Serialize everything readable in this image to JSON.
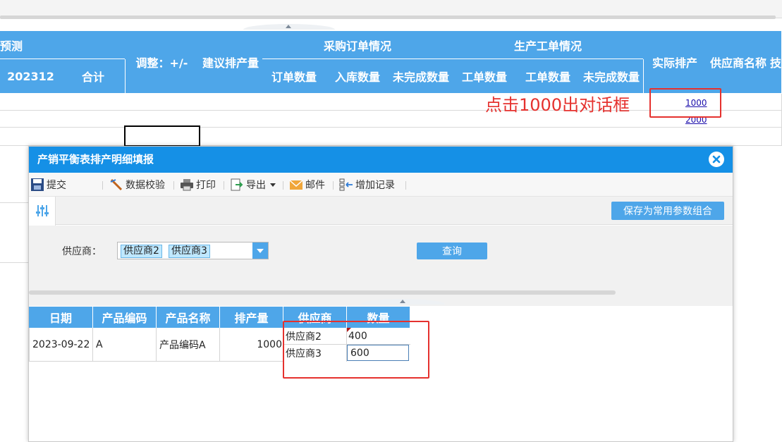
{
  "report": {
    "header": {
      "forecast": "预测",
      "month": "202312",
      "total": "合计",
      "adjust": "调整：+/-",
      "suggested": "建议排产量",
      "purchase_group": "采购订单情况",
      "purchase_cols": [
        "订单数量",
        "入库数量",
        "未完成数量"
      ],
      "production_group": "生产工单情况",
      "production_cols": [
        "工单数量",
        "工单数量",
        "未完成数量"
      ],
      "actual": "实际排产",
      "supplier_name": "供应商名称",
      "cut_off": "技"
    },
    "rows": [
      {
        "actual_link": "1000"
      },
      {
        "actual_link": "2000"
      }
    ],
    "annotation": "点击1000出对话框"
  },
  "dialog": {
    "title": "产销平衡表排产明细填报",
    "toolbar": {
      "submit": "提交",
      "validate": "数据校验",
      "print": "打印",
      "export": "导出",
      "mail": "邮件",
      "add_record": "增加记录"
    },
    "params": {
      "save_combo": "保存为常用参数组合",
      "supplier_label": "供应商：",
      "supplier_selected": [
        "供应商2",
        "供应商3"
      ],
      "query": "查询"
    },
    "table": {
      "headers": [
        "日期",
        "产品编码",
        "产品名称",
        "排产量",
        "供应商",
        "数量"
      ],
      "row": {
        "date": "2023-09-22",
        "code": "A",
        "name": "产品编码A",
        "qty": "1000",
        "subs": [
          {
            "supplier": "供应商2",
            "amount": "400"
          },
          {
            "supplier": "供应商3",
            "amount": "600"
          }
        ]
      }
    }
  },
  "colors": {
    "header_blue": "#4ea6e9",
    "title_blue": "#1590e6",
    "annotation_red": "#e5312e"
  }
}
